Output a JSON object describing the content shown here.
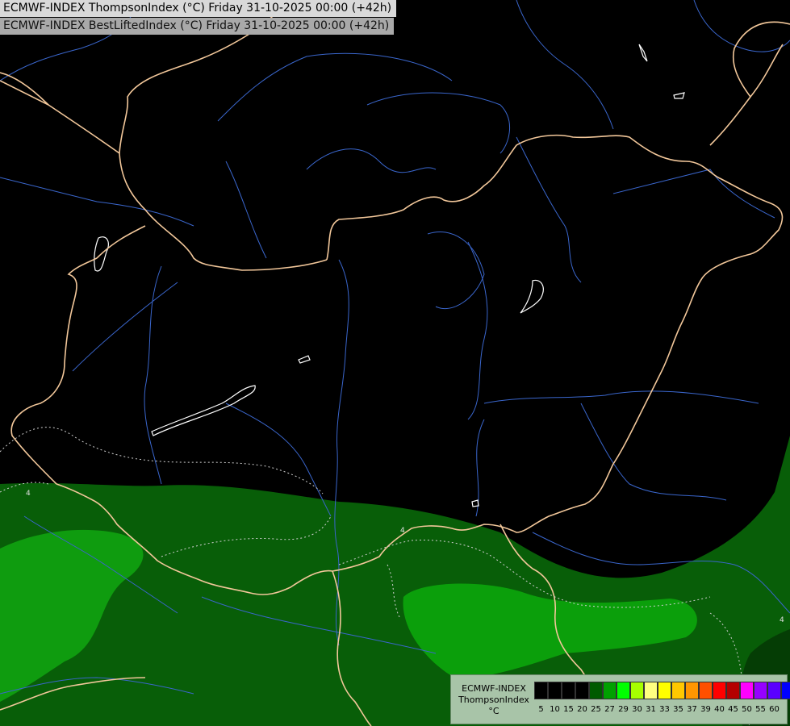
{
  "header": {
    "title_main": "ECMWF-INDEX ThompsonIndex (°C) Friday 31-10-2025 00:00 (+42h)",
    "title_sub": "ECMWF-INDEX BestLiftedIndex (°C) Friday 31-10-2025 00:00 (+42h)"
  },
  "legend": {
    "line1": "ECMWF-INDEX",
    "line2": "ThompsonIndex",
    "line3": "°C",
    "ticks": [
      "5",
      "10",
      "15",
      "20",
      "25",
      "27",
      "29",
      "30",
      "31",
      "33",
      "35",
      "37",
      "39",
      "40",
      "45",
      "50",
      "55",
      "60"
    ],
    "colors": [
      "#000000",
      "#000000",
      "#000000",
      "#000000",
      "#005a00",
      "#00a000",
      "#00ff00",
      "#a6ff00",
      "#ffff80",
      "#ffff00",
      "#ffc800",
      "#ff9600",
      "#ff5000",
      "#ff0000",
      "#b40000",
      "#ff00ff",
      "#9600ff",
      "#5a00ff",
      "#0000ff"
    ]
  },
  "colors": {
    "background": "#000000",
    "border_line": "#f5c99a",
    "river": "#3f6fd8",
    "lake": "#ffffff",
    "dark_green": "#075d07",
    "mid_green": "#00a000",
    "bright_green": "#15b515"
  },
  "markers": [
    "4",
    "4",
    "4"
  ]
}
